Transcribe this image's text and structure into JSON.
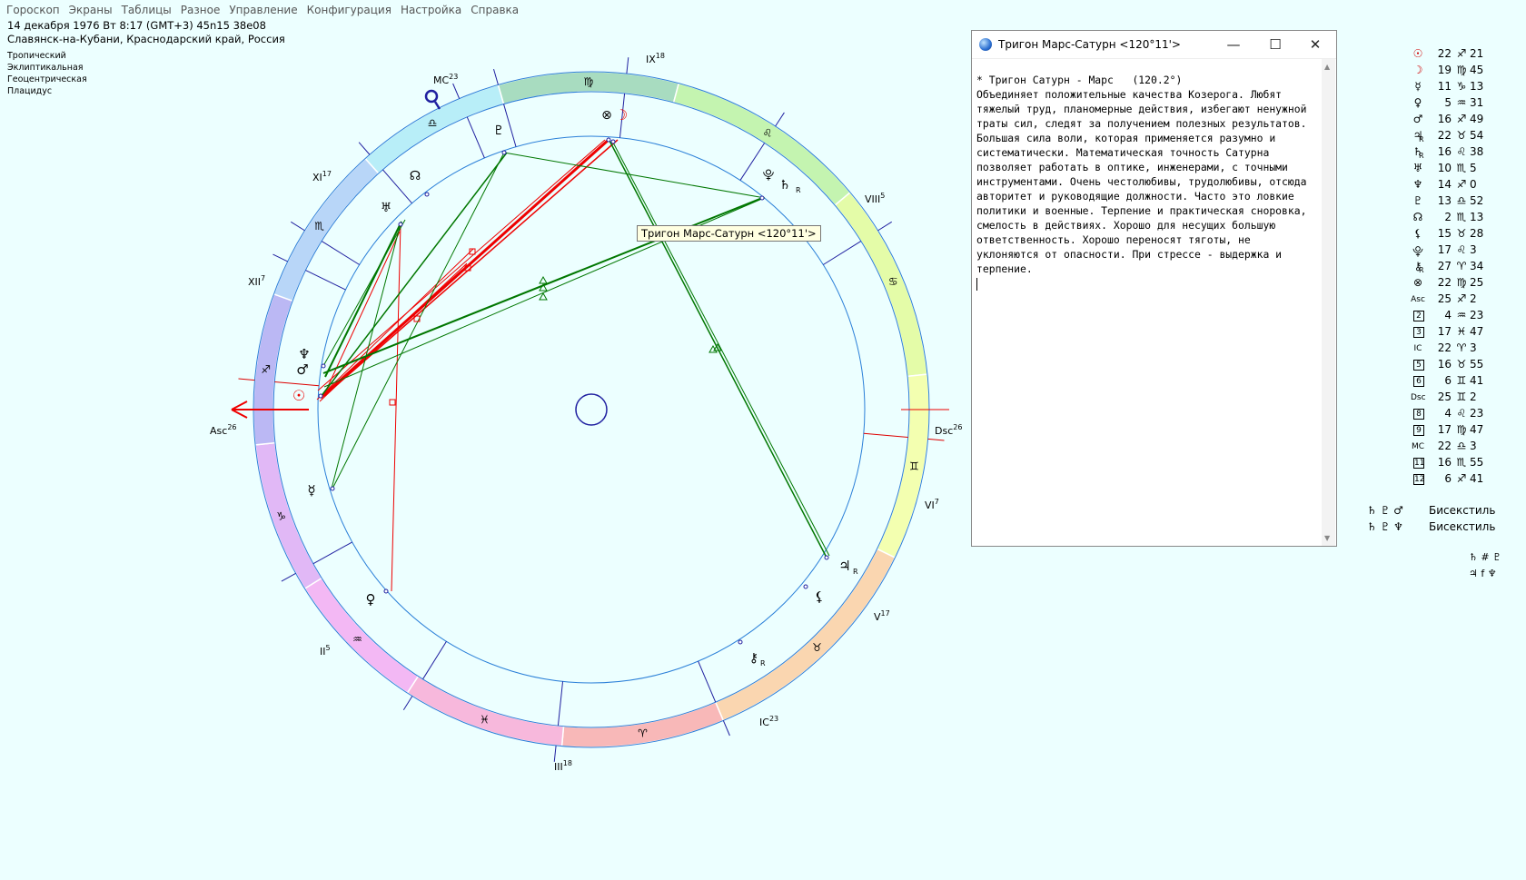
{
  "menu": [
    "Гороскоп",
    "Экраны",
    "Таблицы",
    "Разное",
    "Управление",
    "Конфигурация",
    "Настройка",
    "Справка"
  ],
  "header": {
    "line1": "14 декабря 1976  Вт   8:17 (GMT+3) 45n15  38e08",
    "line2": "Славянск-на-Кубани, Краснодарский край, Россия",
    "settings": [
      "Тропический",
      "Эклиптикальная",
      "Геоцентрическая",
      "Плацидус"
    ]
  },
  "chart": {
    "houses": {
      "asc": "Asc",
      "asc_deg": "26",
      "dsc": "Dsc",
      "dsc_deg": "26",
      "mc": "MC",
      "mc_deg": "23",
      "ic": "IC",
      "ic_deg": "23",
      "ii": "II",
      "ii_deg": "5",
      "iii": "III",
      "iii_deg": "18",
      "v": "V",
      "v_deg": "17",
      "vi": "VI",
      "vi_deg": "7",
      "viii": "VIII",
      "viii_deg": "5",
      "ix": "IX",
      "ix_deg": "18",
      "xi": "XI",
      "xi_deg": "17",
      "xii": "XII",
      "xii_deg": "7"
    },
    "zodiac_colors": [
      "#8ff0a0",
      "#cbf59a",
      "#f3ffa0",
      "#fad6b0",
      "#f8b8b8",
      "#f7b8dc",
      "#f3b8f4",
      "#d7b8f5",
      "#b8b8f4",
      "#b8d8f8",
      "#b8eef8",
      "#b4f8f4"
    ],
    "aspect_colors": {
      "trine": "#007000",
      "square": "#ff0000"
    }
  },
  "tooltip": "Тригон Марс-Сатурн <120°11'>",
  "popup": {
    "title": "Тригон Марс-Сатурн <120°11'>",
    "text": "* Тригон Сатурн - Марс   (120.2°)\nОбъединяет положительные качества Козерога. Любят тяжелый труд, планомерные действия, избегают ненужной траты сил, следят за получением полезных результатов. Большая сила воли, которая применяется разумно и систематически. Математическая точность Сатурна позволяет работать в оптике, инженерами, с точными инструментами. Очень честолюбивы, трудолюбивы, отсюда авторитет и руководящие должности. Часто это ловкие политики и военные. Терпение и практическая сноровка, смелость в действиях. Хорошо для несущих большую ответственность. Хорошо переносят тяготы, не уклоняются от опасности. При стрессе - выдержка и терпение."
  },
  "positions": [
    {
      "glyph": "☉",
      "color": "#d00000",
      "deg": "22",
      "sign": "♐",
      "min": "21",
      "r": ""
    },
    {
      "glyph": "☽",
      "color": "#d00000",
      "deg": "19",
      "sign": "♍",
      "min": "45",
      "r": ""
    },
    {
      "glyph": "☿",
      "color": "#000",
      "deg": "11",
      "sign": "♑",
      "min": "13",
      "r": ""
    },
    {
      "glyph": "♀",
      "color": "#000",
      "deg": "5",
      "sign": "♒",
      "min": "31",
      "r": ""
    },
    {
      "glyph": "♂",
      "color": "#000",
      "deg": "16",
      "sign": "♐",
      "min": "49",
      "r": ""
    },
    {
      "glyph": "♃",
      "color": "#000",
      "deg": "22",
      "sign": "♉",
      "min": "54",
      "r": "R"
    },
    {
      "glyph": "♄",
      "color": "#000",
      "deg": "16",
      "sign": "♌",
      "min": "38",
      "r": "R"
    },
    {
      "glyph": "♅",
      "color": "#000",
      "deg": "10",
      "sign": "♏",
      "min": "5",
      "r": ""
    },
    {
      "glyph": "♆",
      "color": "#000",
      "deg": "14",
      "sign": "♐",
      "min": "0",
      "r": ""
    },
    {
      "glyph": "♇",
      "color": "#000",
      "deg": "13",
      "sign": "♎",
      "min": "52",
      "r": ""
    },
    {
      "glyph": "☊",
      "color": "#000",
      "deg": "2",
      "sign": "♏",
      "min": "13",
      "r": ""
    },
    {
      "glyph": "⚸",
      "color": "#000",
      "deg": "15",
      "sign": "♉",
      "min": "28",
      "r": ""
    },
    {
      "glyph": "⯓",
      "color": "#000",
      "deg": "17",
      "sign": "♌",
      "min": "3",
      "r": ""
    },
    {
      "glyph": "⚷",
      "color": "#000",
      "deg": "27",
      "sign": "♈",
      "min": "34",
      "r": "R"
    },
    {
      "glyph": "⊗",
      "color": "#000",
      "deg": "22",
      "sign": "♍",
      "min": "25",
      "r": ""
    },
    {
      "glyph": "Asc",
      "color": "#000",
      "deg": "25",
      "sign": "♐",
      "min": "2",
      "r": ""
    },
    {
      "glyph": "2",
      "color": "#000",
      "deg": "4",
      "sign": "♒",
      "min": "23",
      "r": ""
    },
    {
      "glyph": "3",
      "color": "#000",
      "deg": "17",
      "sign": "♓",
      "min": "47",
      "r": ""
    },
    {
      "glyph": "IC",
      "color": "#000",
      "deg": "22",
      "sign": "♈",
      "min": "3",
      "r": ""
    },
    {
      "glyph": "5",
      "color": "#000",
      "deg": "16",
      "sign": "♉",
      "min": "55",
      "r": ""
    },
    {
      "glyph": "6",
      "color": "#000",
      "deg": "6",
      "sign": "♊",
      "min": "41",
      "r": ""
    },
    {
      "glyph": "Dsc",
      "color": "#000",
      "deg": "25",
      "sign": "♊",
      "min": "2",
      "r": ""
    },
    {
      "glyph": "8",
      "color": "#000",
      "deg": "4",
      "sign": "♌",
      "min": "23",
      "r": ""
    },
    {
      "glyph": "9",
      "color": "#000",
      "deg": "17",
      "sign": "♍",
      "min": "47",
      "r": ""
    },
    {
      "glyph": "MC",
      "color": "#000",
      "deg": "22",
      "sign": "♎",
      "min": "3",
      "r": ""
    },
    {
      "glyph": "11",
      "color": "#000",
      "deg": "16",
      "sign": "♏",
      "min": "55",
      "r": ""
    },
    {
      "glyph": "12",
      "color": "#000",
      "deg": "6",
      "sign": "♐",
      "min": "41",
      "r": ""
    }
  ],
  "configurations": [
    {
      "glyphs": "♄ ♇ ♂",
      "label": "Бисекстиль"
    },
    {
      "glyphs": "♄ ♇ ♆",
      "label": "Бисекстиль"
    }
  ],
  "misc": [
    "♄ # ♇",
    "♃ f ♆"
  ]
}
